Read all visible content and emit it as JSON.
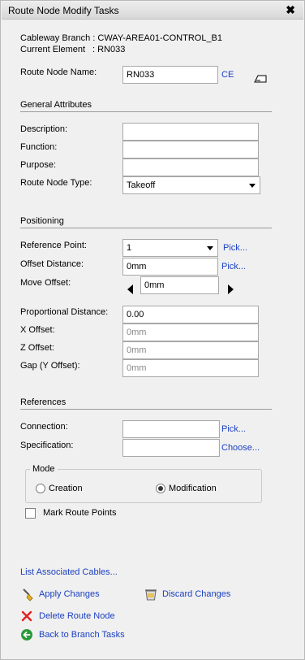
{
  "window": {
    "title": "Route Node Modify Tasks",
    "close_glyph": "✖"
  },
  "header": {
    "branch_label": "Cableway Branch : CWAY-AREA01-CONTROL_B1",
    "element_label": "Current Element",
    "element_value": ": RN033"
  },
  "route_node_name": {
    "label": "Route Node Name:",
    "value": "RN033",
    "ce_link": "CE"
  },
  "general": {
    "title": "General Attributes",
    "description_label": "Description:",
    "description_value": "",
    "function_label": "Function:",
    "function_value": "",
    "purpose_label": "Purpose:",
    "purpose_value": "",
    "type_label": "Route Node Type:",
    "type_value": "Takeoff"
  },
  "positioning": {
    "title": "Positioning",
    "reference_label": "Reference Point:",
    "reference_value": "1",
    "reference_pick": "Pick...",
    "offset_label": "Offset Distance:",
    "offset_value": "0mm",
    "offset_pick": "Pick...",
    "move_label": "Move Offset:",
    "move_value": "0mm",
    "proportional_label": "Proportional Distance:",
    "proportional_value": "0.00",
    "x_label": "X Offset:",
    "x_value": "0mm",
    "z_label": "Z Offset:",
    "z_value": "0mm",
    "gap_label": "Gap (Y Offset):",
    "gap_value": "0mm"
  },
  "references": {
    "title": "References",
    "connection_label": "Connection:",
    "connection_value": "",
    "connection_pick": "Pick...",
    "spec_label": "Specification:",
    "spec_value": "",
    "spec_choose": "Choose..."
  },
  "mode": {
    "title": "Mode",
    "creation": "Creation",
    "modification": "Modification",
    "selected": "Modification"
  },
  "mark_route_points": {
    "label": "Mark Route Points",
    "checked": false
  },
  "actions": {
    "list_cables": "List Associated Cables...",
    "apply": "Apply Changes",
    "discard": "Discard Changes",
    "delete": "Delete Route Node",
    "back": "Back to Branch Tasks"
  },
  "colors": {
    "link": "#1a3fc1",
    "delete_red": "#e02020",
    "back_green": "#2a9a3a"
  }
}
